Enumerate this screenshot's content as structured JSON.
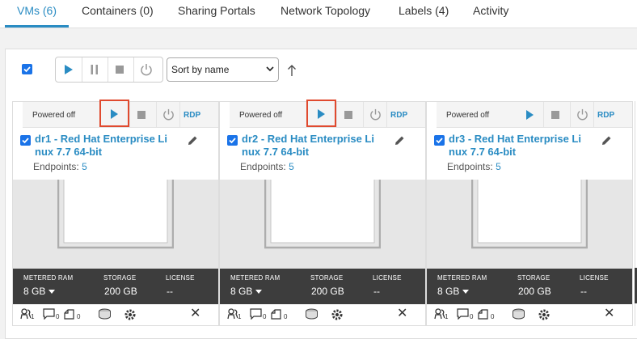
{
  "tabs": [
    {
      "label": "VMs (6)"
    },
    {
      "label": "Containers (0)"
    },
    {
      "label": "Sharing Portals"
    },
    {
      "label": "Network Topology"
    },
    {
      "label": "Labels (4)"
    },
    {
      "label": "Activity"
    }
  ],
  "toolbar": {
    "sort_value": "Sort by name"
  },
  "stat_labels": {
    "ram": "METERED RAM",
    "storage": "STORAGE",
    "license": "LICENSE"
  },
  "cards": [
    {
      "status": "Powered off",
      "rdp": "RDP",
      "name_line1": "dr1 - Red Hat Enterprise Li",
      "name_line2": "nux 7.7 64-bit",
      "endpoints_label": "Endpoints:",
      "endpoints_count": "5",
      "ram": "8 GB",
      "storage": "200 GB",
      "license": "--",
      "counts": {
        "users": "1",
        "comments": "0",
        "notes": "0"
      }
    },
    {
      "status": "Powered off",
      "rdp": "RDP",
      "name_line1": "dr2 - Red Hat Enterprise Li",
      "name_line2": "nux 7.7 64-bit",
      "endpoints_label": "Endpoints:",
      "endpoints_count": "5",
      "ram": "8 GB",
      "storage": "200 GB",
      "license": "--",
      "counts": {
        "users": "1",
        "comments": "0",
        "notes": "0"
      }
    },
    {
      "status": "Powered off",
      "rdp": "RDP",
      "name_line1": "dr3 - Red Hat Enterprise Li",
      "name_line2": "nux 7.7 64-bit",
      "endpoints_label": "Endpoints:",
      "endpoints_count": "5",
      "ram": "8 GB",
      "storage": "200 GB",
      "license": "--",
      "counts": {
        "users": "1",
        "comments": "0",
        "notes": "0"
      }
    }
  ],
  "colors": {
    "accent": "#2a8cc3",
    "highlight": "#e04a2f",
    "stats_bar": "#3d3d3d"
  }
}
